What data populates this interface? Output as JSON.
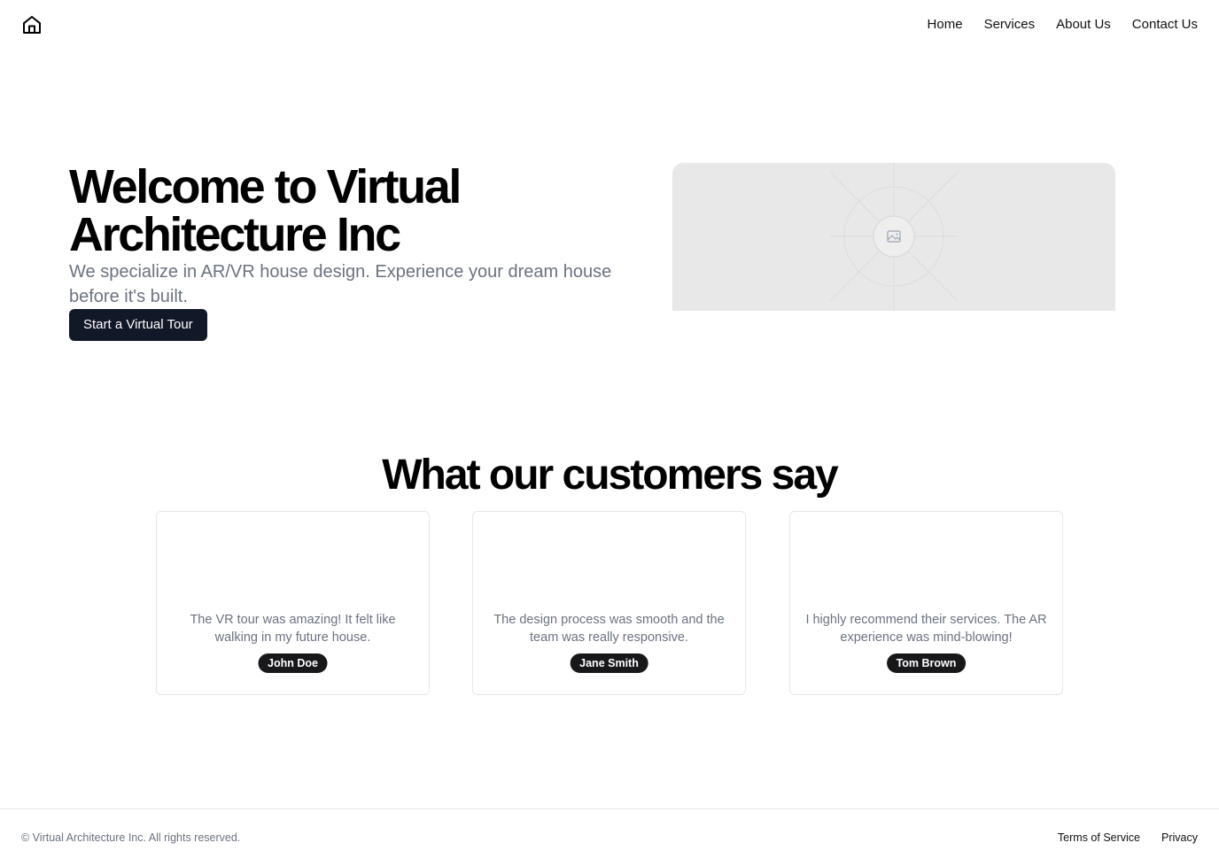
{
  "header": {
    "logo_icon": "home-icon",
    "nav": [
      {
        "label": "Home"
      },
      {
        "label": "Services"
      },
      {
        "label": "About Us"
      },
      {
        "label": "Contact Us"
      }
    ]
  },
  "hero": {
    "title": "Welcome to Virtual Architecture Inc",
    "subtitle": "We specialize in AR/VR house design. Experience your dream house before it's built.",
    "cta_label": "Start a Virtual Tour",
    "image_icon": "image-placeholder-icon"
  },
  "testimonials": {
    "title": "What our customers say",
    "items": [
      {
        "quote": "The VR tour was amazing! It felt like walking in my future house.",
        "name": "John Doe"
      },
      {
        "quote": "The design process was smooth and the team was really responsive.",
        "name": "Jane Smith"
      },
      {
        "quote": "I highly recommend their services. The AR experience was mind-blowing!",
        "name": "Tom Brown"
      }
    ]
  },
  "footer": {
    "copyright": "© Virtual Architecture Inc. All rights reserved.",
    "links": [
      {
        "label": "Terms of Service"
      },
      {
        "label": "Privacy"
      }
    ]
  },
  "colors": {
    "primary_button": "#111827",
    "badge": "#18181b",
    "muted_text": "#6b7280",
    "border": "#e5e7eb",
    "placeholder_bg": "#e8e8e8"
  }
}
